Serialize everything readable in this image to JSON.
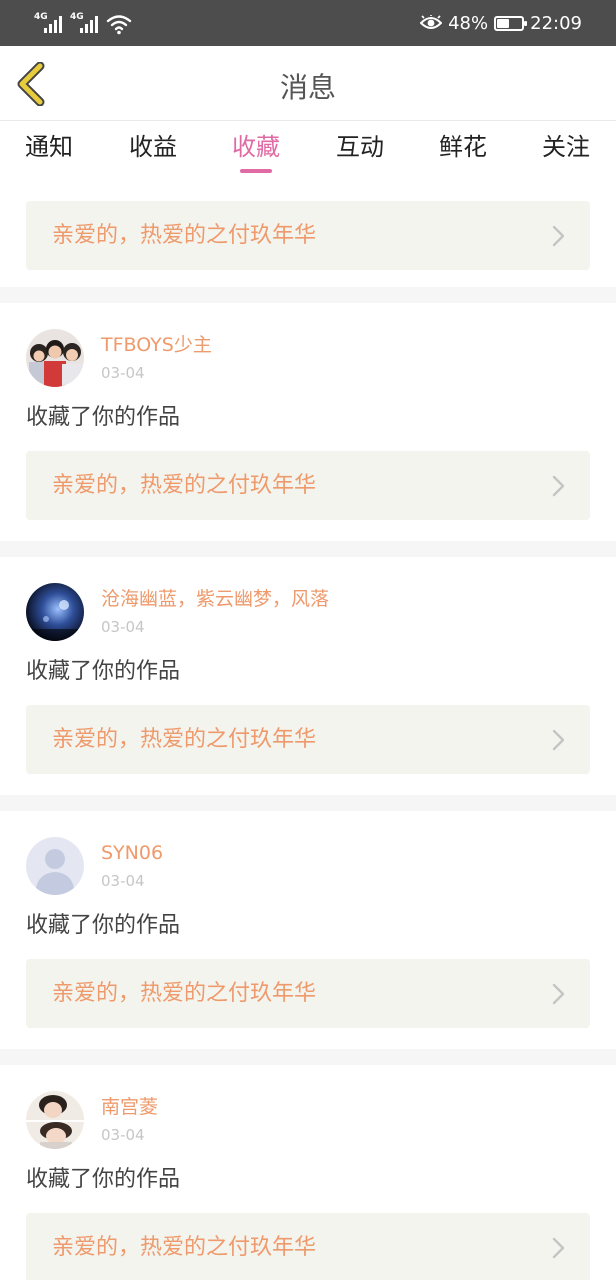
{
  "status_bar": {
    "net1": "4G",
    "net2": "4G",
    "battery_pct": "48%",
    "battery_level": 0.48,
    "time": "22:09"
  },
  "nav": {
    "title": "消息"
  },
  "tabs": [
    {
      "label": "通知"
    },
    {
      "label": "收益"
    },
    {
      "label": "收藏",
      "active": true
    },
    {
      "label": "互动"
    },
    {
      "label": "鲜花"
    },
    {
      "label": "关注"
    }
  ],
  "top_work": {
    "title": "亲爱的，热爱的之付玖年华"
  },
  "messages": [
    {
      "user": "TFBOYS少主",
      "date": "03-04",
      "action": "收藏了你的作品",
      "work": "亲爱的，热爱的之付玖年华",
      "avatar": "group-photo"
    },
    {
      "user": "沧海幽蓝，紫云幽梦，风落",
      "date": "03-04",
      "action": "收藏了你的作品",
      "work": "亲爱的，热爱的之付玖年华",
      "avatar": "dark-blue-scene"
    },
    {
      "user": "SYN06",
      "date": "03-04",
      "action": "收藏了你的作品",
      "work": "亲爱的，热爱的之付玖年华",
      "avatar": "default-avatar"
    },
    {
      "user": "南宫菱",
      "date": "03-04",
      "action": "收藏了你的作品",
      "work": "亲爱的，热爱的之付玖年华",
      "avatar": "portrait-photo"
    }
  ],
  "colors": {
    "accent": "#e06aa4",
    "name": "#ee9a6c",
    "back_arrow": "#e8cc3c",
    "status_bar": "#4d4d4d"
  }
}
